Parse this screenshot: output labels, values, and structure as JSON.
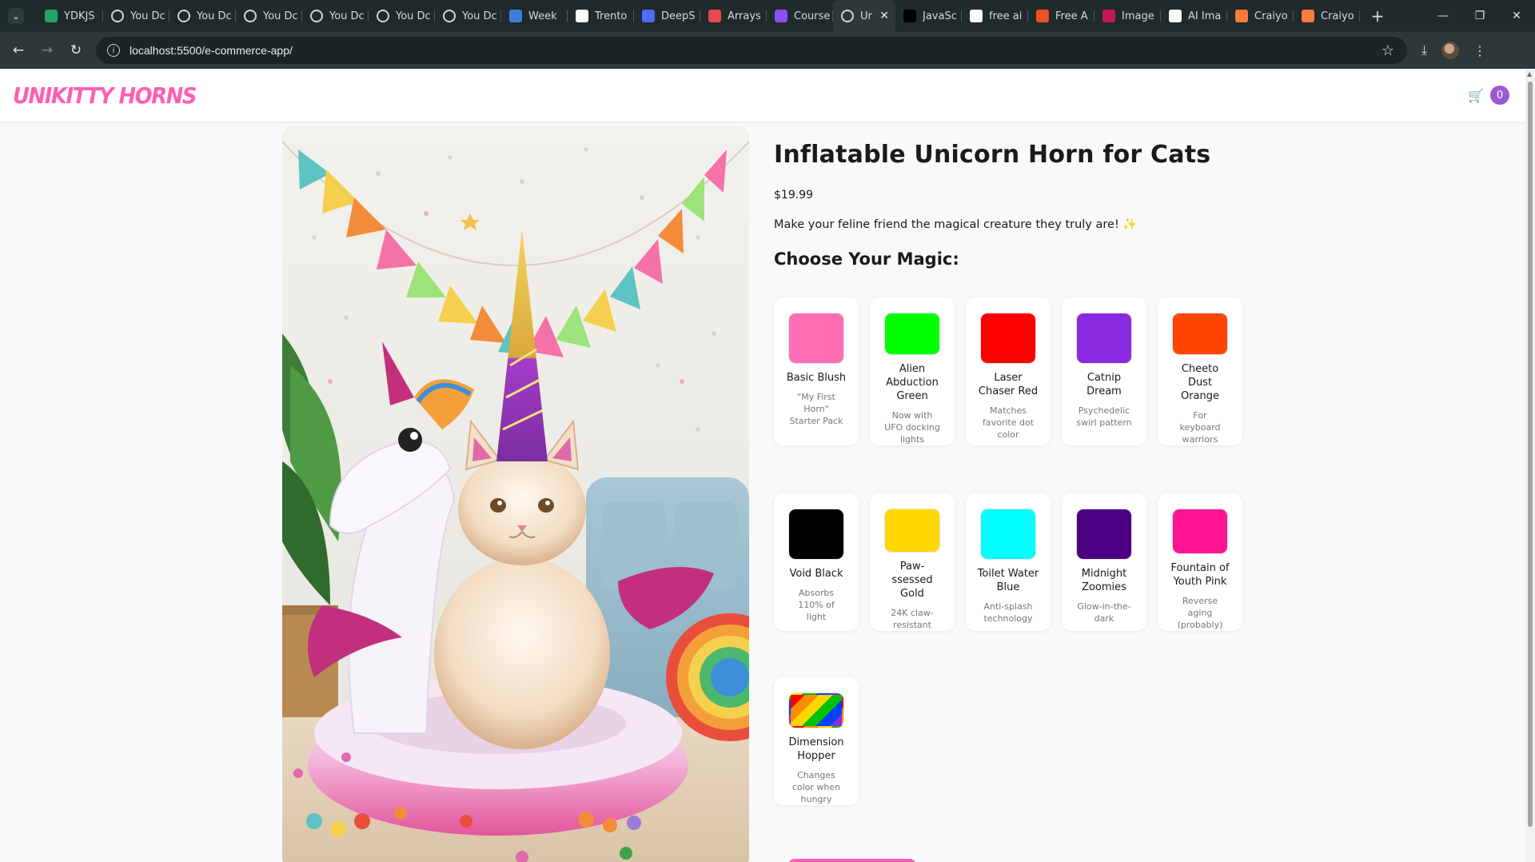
{
  "browser": {
    "tabs": [
      {
        "label": "YDKJS",
        "favicon": "sheets-icon",
        "color": "#1fa463"
      },
      {
        "label": "You Dc",
        "favicon": "globe-icon",
        "color": "#cfd5d5"
      },
      {
        "label": "You Dc",
        "favicon": "globe-icon",
        "color": "#cfd5d5"
      },
      {
        "label": "You Dc",
        "favicon": "globe-icon",
        "color": "#cfd5d5"
      },
      {
        "label": "You Dc",
        "favicon": "globe-icon",
        "color": "#cfd5d5"
      },
      {
        "label": "You Dc",
        "favicon": "globe-icon",
        "color": "#cfd5d5"
      },
      {
        "label": "You Dc",
        "favicon": "globe-icon",
        "color": "#cfd5d5"
      },
      {
        "label": "Week",
        "favicon": "image-icon",
        "color": "#3b7ddd"
      },
      {
        "label": "Trento",
        "favicon": "github-icon",
        "color": "#ffffff"
      },
      {
        "label": "DeepS",
        "favicon": "deepseek-icon",
        "color": "#4d6bfe"
      },
      {
        "label": "Arrays",
        "favicon": "arrays-icon",
        "color": "#e5484d"
      },
      {
        "label": "Course",
        "favicon": "course-icon",
        "color": "#8a4fff"
      },
      {
        "label": "Ur",
        "favicon": "globe-icon",
        "color": "#cfd5d5",
        "active": true
      },
      {
        "label": "JavaSc",
        "favicon": "medium-icon",
        "color": "#000000"
      },
      {
        "label": "free ai",
        "favicon": "google-icon",
        "color": "#ffffff"
      },
      {
        "label": "Free A",
        "favicon": "microsoft-icon",
        "color": "#f25022"
      },
      {
        "label": "Image",
        "favicon": "image-gen-icon",
        "color": "#c2185b"
      },
      {
        "label": "AI Ima",
        "favicon": "openai-icon",
        "color": "#ffffff"
      },
      {
        "label": "Craiyo",
        "favicon": "pencil-icon",
        "color": "#ff7a3d"
      },
      {
        "label": "Craiyo",
        "favicon": "pencil-icon",
        "color": "#ff7a3d"
      }
    ],
    "url": "localhost:5500/e-commerce-app/"
  },
  "header": {
    "logo": "UNIKITTY HORNS",
    "cart_count": "0"
  },
  "product": {
    "title": "Inflatable Unicorn Horn for Cats",
    "price": "$19.99",
    "description": "Make your feline friend the magical creature they truly are! ✨",
    "choose_heading": "Choose Your Magic:"
  },
  "options": [
    {
      "name": "Basic Blush",
      "desc": "\"My First Horn\" Starter Pack",
      "color": "#ff6eb4"
    },
    {
      "name": "Alien Abduction Green",
      "desc": "Now with UFO docking lights",
      "color": "#00ff00"
    },
    {
      "name": "Laser Chaser Red",
      "desc": "Matches favorite dot color",
      "color": "#ff0000"
    },
    {
      "name": "Catnip Dream",
      "desc": "Psychedelic swirl pattern",
      "color": "#8a2be2"
    },
    {
      "name": "Cheeto Dust Orange",
      "desc": "For keyboard warriors",
      "color": "#ff4500"
    },
    {
      "name": "Void Black",
      "desc": "Absorbs 110% of light",
      "color": "#000000"
    },
    {
      "name": "Paw-ssessed Gold",
      "desc": "24K claw-resistant",
      "color": "#ffd700"
    },
    {
      "name": "Toilet Water Blue",
      "desc": "Anti-splash technology",
      "color": "#00ffff"
    },
    {
      "name": "Midnight Zoomies",
      "desc": "Glow-in-the-dark",
      "color": "#4b0082"
    },
    {
      "name": "Fountain of Youth Pink",
      "desc": "Reverse aging (probably)",
      "color": "#ff1493"
    },
    {
      "name": "Dimension Hopper",
      "desc": "Changes color when hungry",
      "color": "rainbow"
    }
  ]
}
